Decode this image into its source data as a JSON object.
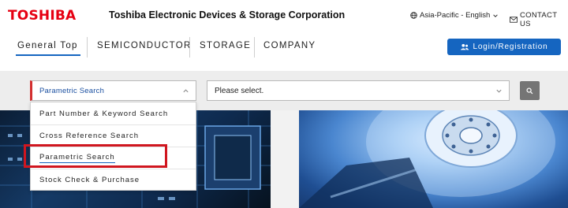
{
  "header": {
    "logo": "TOSHIBA",
    "corporation": "Toshiba Electronic Devices & Storage Corporation",
    "language": "Asia-Pacific - English",
    "contact": "CONTACT US"
  },
  "nav": {
    "items": [
      {
        "label": "General Top",
        "active": true
      },
      {
        "label": "SEMICONDUCTOR",
        "active": false
      },
      {
        "label": "STORAGE",
        "active": false
      },
      {
        "label": "COMPANY",
        "active": false
      }
    ],
    "login_label": "Login/Registration"
  },
  "search": {
    "type_select_value": "Parametric Search",
    "category_select_value": "Please select.",
    "menu": [
      {
        "label": "Part Number & Keyword Search"
      },
      {
        "label": "Cross Reference Search"
      },
      {
        "label": "Parametric Search",
        "selected": true
      },
      {
        "label": "Stock Check & Purchase"
      }
    ]
  },
  "colors": {
    "brand_red": "#e60012",
    "accent_blue": "#1565c0",
    "highlight_red": "#d0161f"
  },
  "icons": {
    "language": "globe-icon",
    "contact": "mail-icon",
    "login": "user-group-icon",
    "search": "search-icon",
    "select": "chevron-down-icon"
  }
}
